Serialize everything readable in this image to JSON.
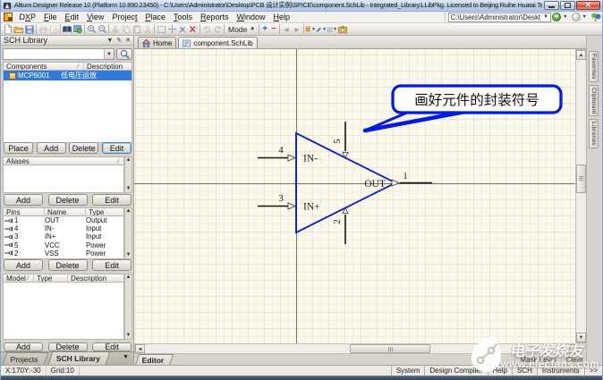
{
  "window": {
    "title": "Altium Designer Release 10 (Platform 10.890.23450) - C:\\Users\\Administrator\\Desktop\\PCB 设计实例\\SPICE\\component.SchLib - Integrated_Library1.LibPkg. Licensed to Beijing Ruihe Huatai Tech Co Lt...",
    "controls": {
      "minimize": "minimize",
      "maximize": "maximize",
      "close": "close"
    }
  },
  "menubar": {
    "items": [
      "DXP",
      "File",
      "Edit",
      "View",
      "Project",
      "Place",
      "Tools",
      "Reports",
      "Window",
      "Help"
    ],
    "path_combo_value": "C:\\Users\\Administrator\\Deskt"
  },
  "toolbar": {
    "mode_label": "Mode",
    "icons": [
      "new-document",
      "open-folder",
      "save",
      "print",
      "print-preview",
      "open-document",
      "browse-library",
      "zoom-in",
      "zoom-out",
      "cut",
      "copy",
      "paste",
      "rubber-stamp",
      "select-area",
      "move-selection",
      "deselect-all",
      "clear-filter",
      "undo",
      "redo",
      "zoom-plus",
      "zoom-minus",
      "back",
      "forward",
      "place-part",
      "ieee-symbols",
      "grids",
      "snapshot"
    ]
  },
  "sch_library_panel": {
    "title": "SCH Library",
    "search_value": "",
    "components": {
      "headers": [
        "Components",
        "Description"
      ],
      "rows": [
        {
          "name": "MCP6001",
          "description": "低电压运放"
        }
      ],
      "buttons": [
        "Place",
        "Add",
        "Delete",
        "Edit"
      ]
    },
    "aliases": {
      "header": "Aliases",
      "buttons": [
        "Add",
        "Delete",
        "Edit"
      ]
    },
    "pins": {
      "headers": [
        "Pins",
        "Name",
        "Type"
      ],
      "rows": [
        {
          "num": "1",
          "name": "OUT",
          "type": "Output"
        },
        {
          "num": "4",
          "name": "IN-",
          "type": "Input"
        },
        {
          "num": "3",
          "name": "IN+",
          "type": "Input"
        },
        {
          "num": "5",
          "name": "VCC",
          "type": "Power"
        },
        {
          "num": "2",
          "name": "VSS",
          "type": "Power"
        }
      ],
      "buttons": [
        "Add",
        "Delete",
        "Edit"
      ]
    },
    "model": {
      "headers": [
        "Model",
        "Type",
        "Description"
      ],
      "buttons": [
        "Add",
        "Delete",
        "Edit"
      ]
    },
    "tabs": [
      "Projects",
      "SCH Library"
    ]
  },
  "document_tabs": [
    {
      "label": "Home"
    },
    {
      "label": "component.SchLib"
    }
  ],
  "schematic": {
    "callout_text": "画好元件的封装符号",
    "labels": {
      "in_minus": "IN-",
      "in_plus": "IN+",
      "out": "OUT"
    },
    "pin_numbers": {
      "p1": "1",
      "p2": "2",
      "p3": "3",
      "p4": "4",
      "p5": "5"
    },
    "colors": {
      "symbol_blue": "#0016dd",
      "callout_blue": "#0018ee",
      "canvas_bg": "#fbf9ec"
    }
  },
  "right_tabs": [
    "Favorites",
    "Clipboard",
    "Libraries"
  ],
  "editor_bar": {
    "tab": "Editor",
    "mask_level": "Mask Level",
    "clear": "Clear"
  },
  "statusbar": {
    "coords": "X:170Y:-30",
    "grid": "Grid:10",
    "panel_buttons": [
      "System",
      "Design Compiler",
      "Help",
      "SCH",
      "Instruments",
      ">>"
    ]
  },
  "watermark": {
    "brand": "电子发烧友",
    "url_text": "www.elecfans.com"
  }
}
